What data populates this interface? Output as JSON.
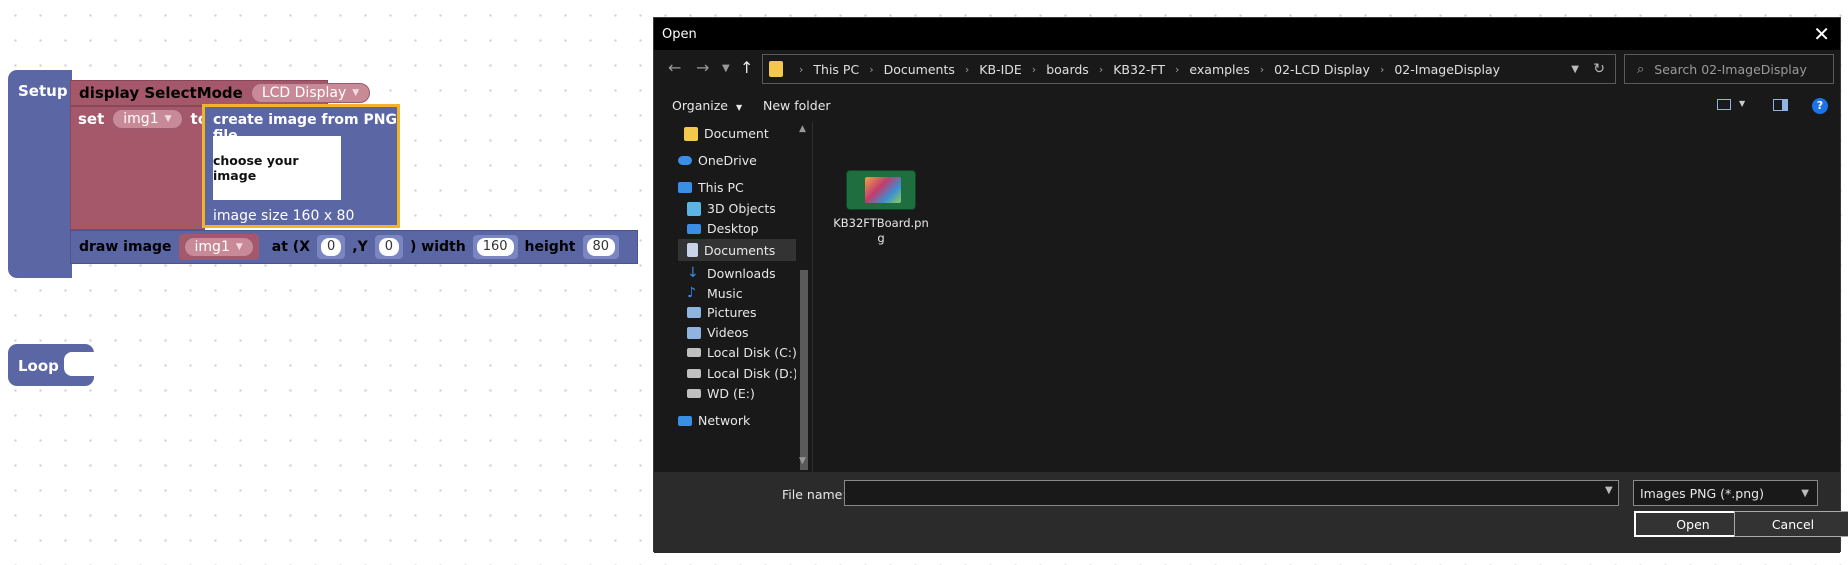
{
  "workspace": {
    "setup_label": "Setup",
    "loop_label": "Loop",
    "display_block": {
      "label": "display SelectMode",
      "mode": "LCD Display"
    },
    "set_block": {
      "set_label": "set",
      "variable": "img1",
      "to_label": "to"
    },
    "image_block": {
      "title": "create image from PNG file",
      "choose_label": "choose your image",
      "size_label": "image size 160 x 80"
    },
    "draw_block": {
      "label": "draw image",
      "variable": "img1",
      "at_x_label": "at (X",
      "x_value": "0",
      "y_label": ",Y",
      "y_value": "0",
      "width_label": ") width",
      "width_value": "160",
      "height_label": "height",
      "height_value": "80"
    }
  },
  "dialog": {
    "title": "Open",
    "breadcrumb": [
      "This PC",
      "Documents",
      "KB-IDE",
      "boards",
      "KB32-FT",
      "examples",
      "02-LCD Display",
      "02-ImageDisplay"
    ],
    "search_placeholder": "Search 02-ImageDisplay",
    "toolbar": {
      "organize": "Organize",
      "new_folder": "New folder"
    },
    "nav_items": [
      {
        "label": "Document",
        "icon": "folder-icon",
        "color": "#f2c94c"
      },
      {
        "label": "OneDrive",
        "icon": "cloud-icon",
        "color": "#3a8ee6"
      },
      {
        "label": "This PC",
        "icon": "pc-icon",
        "color": "#3a8ee6"
      },
      {
        "label": "3D Objects",
        "icon": "cube-icon",
        "color": "#5ab4e8"
      },
      {
        "label": "Desktop",
        "icon": "desktop-icon",
        "color": "#3a8ee6"
      },
      {
        "label": "Documents",
        "icon": "document-icon",
        "color": "#c8d4e8"
      },
      {
        "label": "Downloads",
        "icon": "download-icon",
        "color": "#3a8ee6"
      },
      {
        "label": "Music",
        "icon": "music-icon",
        "color": "#3a8ee6"
      },
      {
        "label": "Pictures",
        "icon": "pictures-icon",
        "color": "#8fb4e0"
      },
      {
        "label": "Videos",
        "icon": "videos-icon",
        "color": "#8fb4e0"
      },
      {
        "label": "Local Disk (C:)",
        "icon": "disk-icon",
        "color": "#c0c0c0"
      },
      {
        "label": "Local Disk (D:)",
        "icon": "disk-icon",
        "color": "#c0c0c0"
      },
      {
        "label": "WD (E:)",
        "icon": "disk-icon",
        "color": "#c0c0c0"
      },
      {
        "label": "Network",
        "icon": "network-icon",
        "color": "#3a8ee6"
      }
    ],
    "file": {
      "name": "KB32FTBoard.png"
    },
    "file_name_label": "File name:",
    "file_name_value": "",
    "filter": "Images PNG (*.png)",
    "open_button": "Open",
    "cancel_button": "Cancel"
  }
}
